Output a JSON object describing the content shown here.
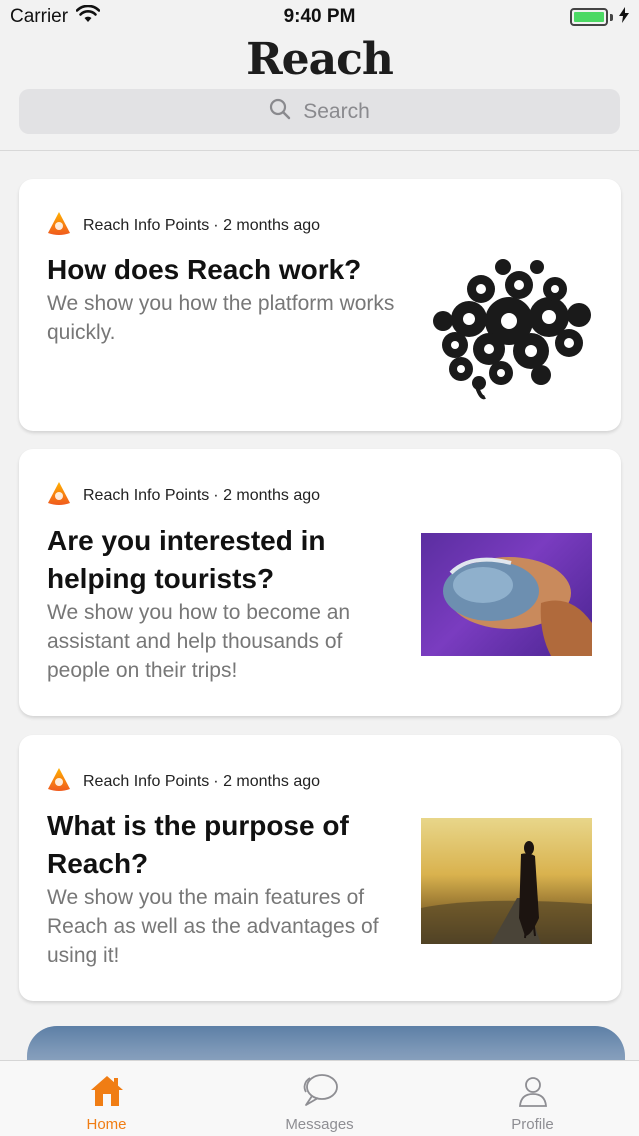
{
  "status_bar": {
    "carrier": "Carrier",
    "time": "9:40 PM",
    "battery_level": 1.0
  },
  "header": {
    "title": "Reach",
    "search_placeholder": "Search"
  },
  "cards": [
    {
      "source": "Reach Info Points",
      "time_ago": "· 2 months ago",
      "title": "How does Reach work?",
      "description": "We show you how the platform works quickly.",
      "thumbnail_icon": "gears-brain-image"
    },
    {
      "source": "Reach Info Points",
      "time_ago": "· 2 months ago",
      "title": "Are you interested in helping tourists?",
      "description": "We show you how to become an assistant and help thousands of people on their trips!",
      "thumbnail_icon": "hands-globe-image"
    },
    {
      "source": "Reach Info Points",
      "time_ago": "· 2 months ago",
      "title": "What is the purpose of Reach?",
      "description": "We show you the main features of Reach as well as the advantages of using it!",
      "thumbnail_icon": "woman-road-image"
    }
  ],
  "tab_bar": {
    "items": [
      {
        "label": "Home",
        "icon": "house-icon",
        "active": true
      },
      {
        "label": "Messages",
        "icon": "chat-bubbles-icon",
        "active": false
      },
      {
        "label": "Profile",
        "icon": "person-icon",
        "active": false
      }
    ]
  },
  "colors": {
    "accent": "#f07d14",
    "inactive_tab": "#8e8e93",
    "background": "#f2f2f2",
    "battery": "#4cd964"
  }
}
